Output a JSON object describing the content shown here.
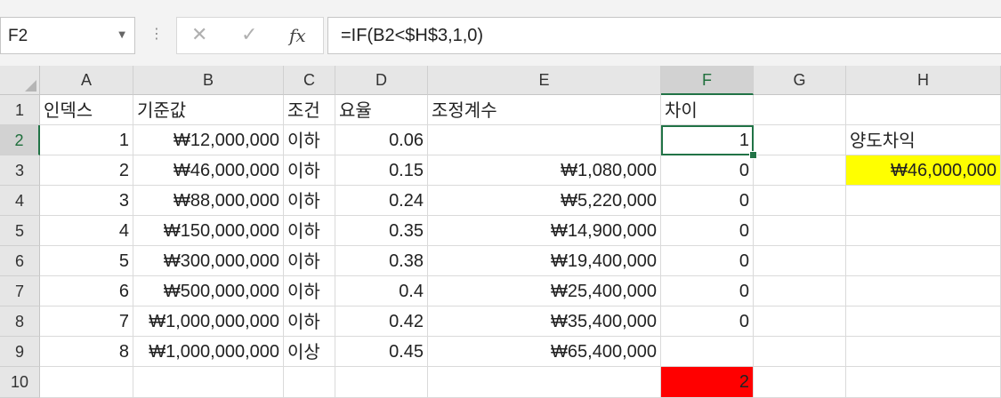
{
  "formula_bar": {
    "name_box": "F2",
    "formula": "=IF(B2<$H$3,1,0)",
    "fx": "fx"
  },
  "columns": [
    "A",
    "B",
    "C",
    "D",
    "E",
    "F",
    "G",
    "H"
  ],
  "rows": [
    "1",
    "2",
    "3",
    "4",
    "5",
    "6",
    "7",
    "8",
    "9",
    "10"
  ],
  "selected_cell": "F2",
  "colors": {
    "highlight_yellow": "#ffff00",
    "highlight_red": "#ff0000",
    "selection_green": "#217346"
  },
  "cells": {
    "A1": "인덱스",
    "B1": "기준값",
    "C1": "조건",
    "D1": "요율",
    "E1": "조정계수",
    "F1": "차이",
    "H1": "",
    "A2": "1",
    "B2": "₩12,000,000",
    "C2": "이하",
    "D2": "0.06",
    "E2": "",
    "F2": "1",
    "H2": "양도차익",
    "A3": "2",
    "B3": "₩46,000,000",
    "C3": "이하",
    "D3": "0.15",
    "E3": "₩1,080,000",
    "F3": "0",
    "H3": "₩46,000,000",
    "A4": "3",
    "B4": "₩88,000,000",
    "C4": "이하",
    "D4": "0.24",
    "E4": "₩5,220,000",
    "F4": "0",
    "A5": "4",
    "B5": "₩150,000,000",
    "C5": "이하",
    "D5": "0.35",
    "E5": "₩14,900,000",
    "F5": "0",
    "A6": "5",
    "B6": "₩300,000,000",
    "C6": "이하",
    "D6": "0.38",
    "E6": "₩19,400,000",
    "F6": "0",
    "A7": "6",
    "B7": "₩500,000,000",
    "C7": "이하",
    "D7": "0.4",
    "E7": "₩25,400,000",
    "F7": "0",
    "A8": "7",
    "B8": "₩1,000,000,000",
    "C8": "이하",
    "D8": "0.42",
    "E8": "₩35,400,000",
    "F8": "0",
    "A9": "8",
    "B9": "₩1,000,000,000",
    "C9": "이상",
    "D9": "0.45",
    "E9": "₩65,400,000",
    "F9": "",
    "F10": "2"
  }
}
